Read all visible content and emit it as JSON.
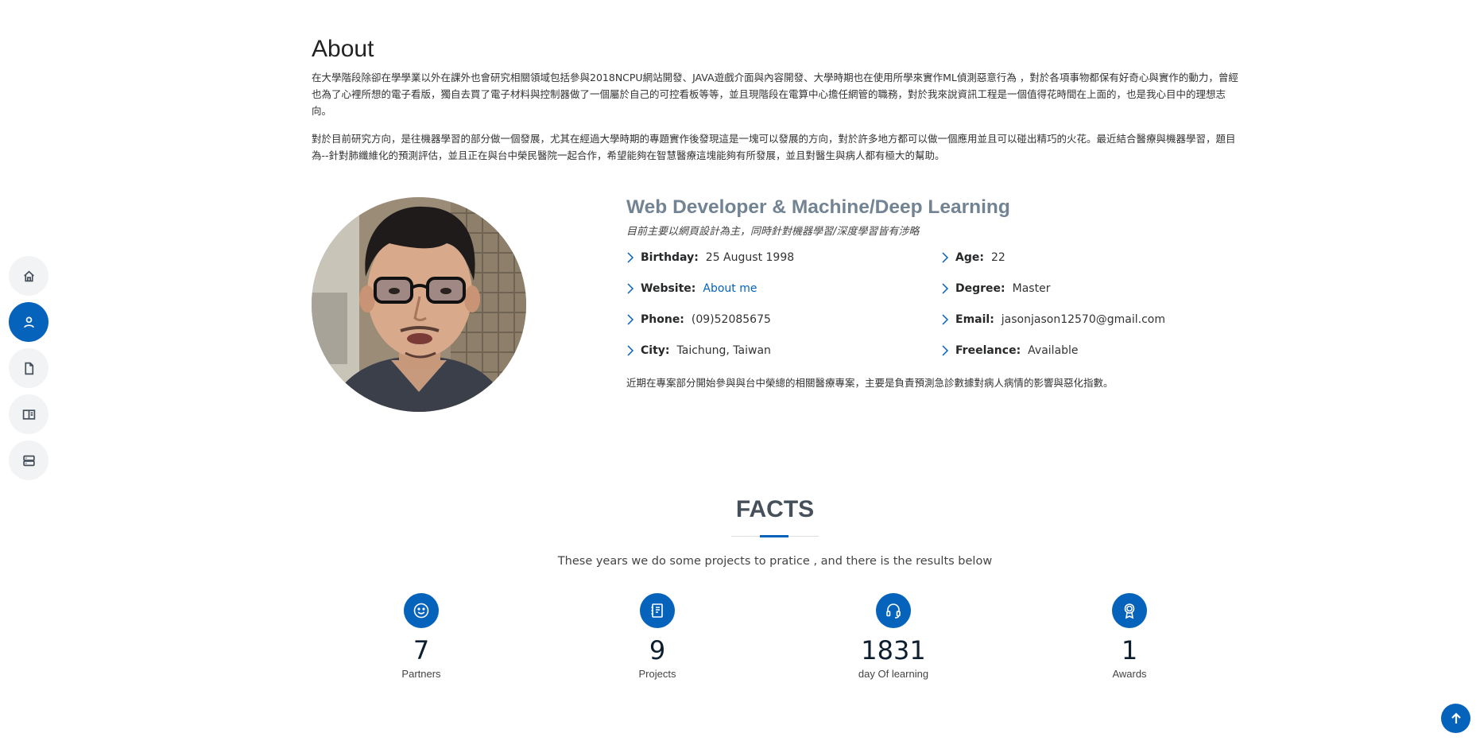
{
  "nav": {
    "items": [
      {
        "icon": "home-icon"
      },
      {
        "icon": "person-icon",
        "active": true
      },
      {
        "icon": "file-icon"
      },
      {
        "icon": "book-icon"
      },
      {
        "icon": "server-icon"
      }
    ]
  },
  "about": {
    "title": "About",
    "paragraph1": "在大學階段除卻在學學業以外在課外也會研究相關領域包括參與2018NCPU網站開發、JAVA遊戲介面與內容開發、大學時期也在使用所學來實作ML偵測惡意行為 ，對於各項事物都保有好奇心與實作的動力，曾經也為了心裡所想的電子看版，獨自去買了電子材料與控制器做了一個屬於自己的可控看板等等，並且現階段在電算中心擔任網管的職務，對於我來說資訊工程是一個值得花時間在上面的，也是我心目中的理想志向。",
    "paragraph2": "對於目前研究方向，是往機器學習的部分做一個發展，尤其在經過大學時期的專題實作後發現這是一塊可以發展的方向，對於許多地方都可以做一個應用並且可以碰出精巧的火花。最近結合醫療與機器學習，題目為--針對肺纖維化的預測評估，並且正在與台中榮民醫院一起合作，希望能夠在智慧醫療這塊能夠有所發展，並且對醫生與病人都有極大的幫助。"
  },
  "profile": {
    "heading": "Web Developer & Machine/Deep Learning",
    "subtitle": "目前主要以網頁設計為主，同時針對機器學習/深度學習皆有涉略",
    "fields": {
      "birthday_label": "Birthday:",
      "birthday": "25 August 1998",
      "age_label": "Age:",
      "age": "22",
      "website_label": "Website:",
      "website": "About me",
      "degree_label": "Degree:",
      "degree": "Master",
      "phone_label": "Phone:",
      "phone": "(09)52085675",
      "email_label": "Email:",
      "email": "jasonjason12570@gmail.com",
      "city_label": "City:",
      "city": "Taichung, Taiwan",
      "freelance_label": "Freelance:",
      "freelance": "Available"
    },
    "note": "近期在專案部分開始參與與台中榮總的相關醫療專案，主要是負責預測急診數據對病人病情的影響與惡化指數。"
  },
  "facts": {
    "title": "FACTS",
    "description": "These years we do some projects to pratice , and there is the results below",
    "counts": [
      {
        "icon": "smile-icon",
        "value": "7",
        "label": "Partners"
      },
      {
        "icon": "journal-icon",
        "value": "9",
        "label": "Projects"
      },
      {
        "icon": "headset-icon",
        "value": "1831",
        "label": "day Of learning"
      },
      {
        "icon": "award-icon",
        "value": "1",
        "label": "Awards"
      }
    ]
  },
  "colors": {
    "accent": "#0563bb",
    "heading_gray": "#728394"
  }
}
